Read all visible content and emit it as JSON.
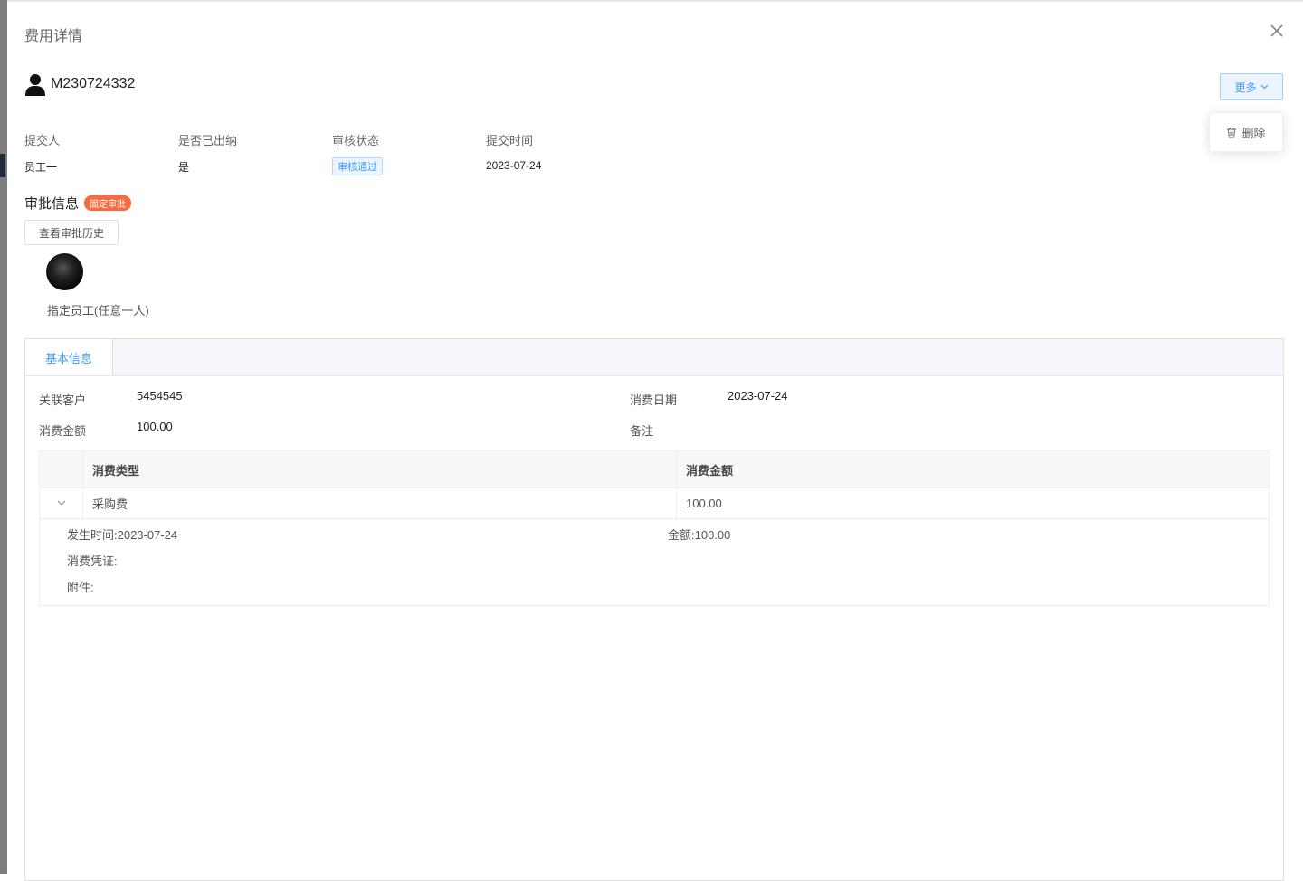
{
  "drawer": {
    "title": "费用详情"
  },
  "record": {
    "id": "M230724332"
  },
  "actions": {
    "more_label": "更多",
    "delete_label": "删除"
  },
  "meta": {
    "submitter_label": "提交人",
    "submitter": "员工一",
    "cashed_label": "是否已出纳",
    "cashed": "是",
    "status_label": "审核状态",
    "status": "审核通过",
    "submit_time_label": "提交时间",
    "submit_time": "2023-07-24"
  },
  "approval": {
    "title": "审批信息",
    "badge": "固定审批",
    "history_button": "查看审批历史",
    "approver": "指定员工(任意一人)"
  },
  "tabs": {
    "basic": "基本信息"
  },
  "basic": {
    "customer_label": "关联客户",
    "customer": "5454545",
    "date_label": "消费日期",
    "date": "2023-07-24",
    "amount_label": "消费金额",
    "amount": "100.00",
    "remark_label": "备注"
  },
  "expense_table": {
    "headers": [
      "消费类型",
      "消费金额"
    ],
    "rows": [
      {
        "type": "采购费",
        "amount": "100.00",
        "detail": {
          "time": "发生时间:2023-07-24",
          "amount": "金额:100.00",
          "voucher_label": "消费凭证:",
          "attachment_label": "附件:"
        }
      }
    ]
  },
  "colors": {
    "accent": "#409eff",
    "badge": "#f56c41"
  }
}
